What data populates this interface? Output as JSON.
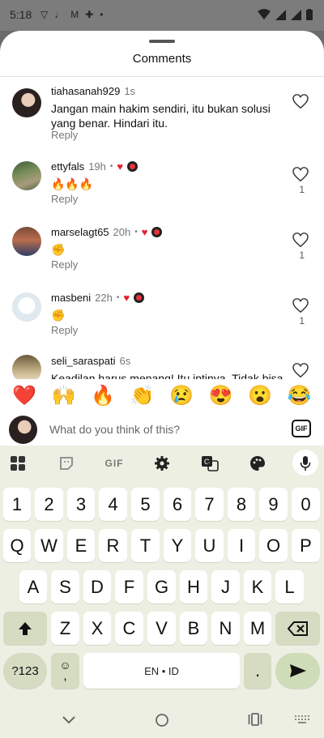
{
  "status_bar": {
    "time": "5:18"
  },
  "sheet": {
    "title": "Comments"
  },
  "comments": [
    {
      "user": "tiahasanah929",
      "ago": "1s",
      "text": "Jangan main hakim sendiri, itu bukan solusi yang benar. Hindari itu.",
      "reply": "Reply",
      "likes": "",
      "reactions": false
    },
    {
      "user": "ettyfals",
      "ago": "19h",
      "text": "🔥🔥🔥",
      "reply": "Reply",
      "likes": "1",
      "reactions": true
    },
    {
      "user": "marselagt65",
      "ago": "20h",
      "text": "✊",
      "reply": "Reply",
      "likes": "1",
      "reactions": true
    },
    {
      "user": "masbeni",
      "ago": "22h",
      "text": "✊",
      "reply": "Reply",
      "likes": "1",
      "reactions": true
    },
    {
      "user": "seli_saraspati",
      "ago": "6s",
      "text": "Keadilan harus menang! Itu intinya. Tidak bisa",
      "reply": "",
      "likes": "",
      "reactions": false
    }
  ],
  "meta_dot": "•",
  "emoji_bar": [
    "❤️",
    "🙌",
    "🔥",
    "👏",
    "😢",
    "😍",
    "😮",
    "😂"
  ],
  "input": {
    "placeholder": "What do you think of this?",
    "gif_label": "GIF"
  },
  "keyboard": {
    "toolbar_gif": "GIF",
    "row_numbers": [
      "1",
      "2",
      "3",
      "4",
      "5",
      "6",
      "7",
      "8",
      "9",
      "0"
    ],
    "row_q": [
      "Q",
      "W",
      "E",
      "R",
      "T",
      "Y",
      "U",
      "I",
      "O",
      "P"
    ],
    "row_a": [
      "A",
      "S",
      "D",
      "F",
      "G",
      "H",
      "J",
      "K",
      "L"
    ],
    "row_z": [
      "Z",
      "X",
      "C",
      "V",
      "B",
      "N",
      "M"
    ],
    "symbols_key": "?123",
    "emoji_comma_top": "☺",
    "emoji_comma_bottom": ",",
    "space_label": "EN • ID",
    "period": "."
  }
}
